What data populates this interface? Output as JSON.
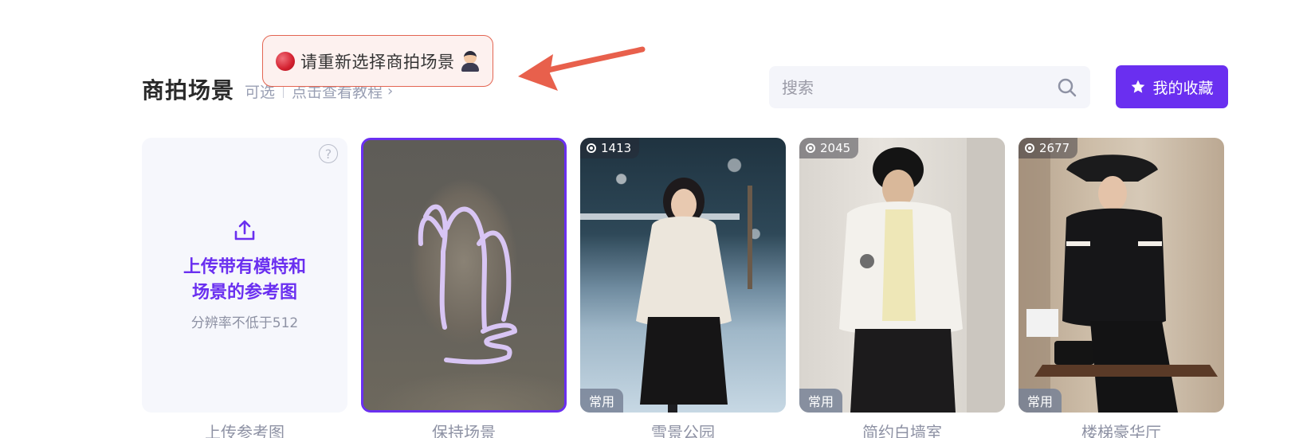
{
  "tooltip": {
    "message": "请重新选择商拍场景"
  },
  "header": {
    "title": "商拍场景",
    "optional": "可选",
    "tutorial_link": "点击查看教程"
  },
  "search": {
    "placeholder": "搜索"
  },
  "favorites_button": {
    "label": "我的收藏"
  },
  "upload_card": {
    "title_line1": "上传带有模特和",
    "title_line2": "场景的参考图",
    "hint": "分辨率不低于512",
    "caption": "上传参考图"
  },
  "scenes": [
    {
      "caption": "保持场景",
      "selected": true
    },
    {
      "caption": "雪景公园",
      "count": "1413",
      "tag": "常用"
    },
    {
      "caption": "简约白墙室",
      "count": "2045",
      "tag": "常用"
    },
    {
      "caption": "楼梯豪华厅",
      "count": "2677",
      "tag": "常用"
    }
  ],
  "colors": {
    "accent": "#6a2ff0",
    "tooltip_border": "#e36552",
    "arrow": "#e8604c"
  },
  "icons": [
    "red-circle-icon",
    "person-emoji-icon",
    "chevron-right-icon",
    "search-icon",
    "star-icon",
    "upload-icon",
    "help-icon",
    "view-count-icon"
  ]
}
